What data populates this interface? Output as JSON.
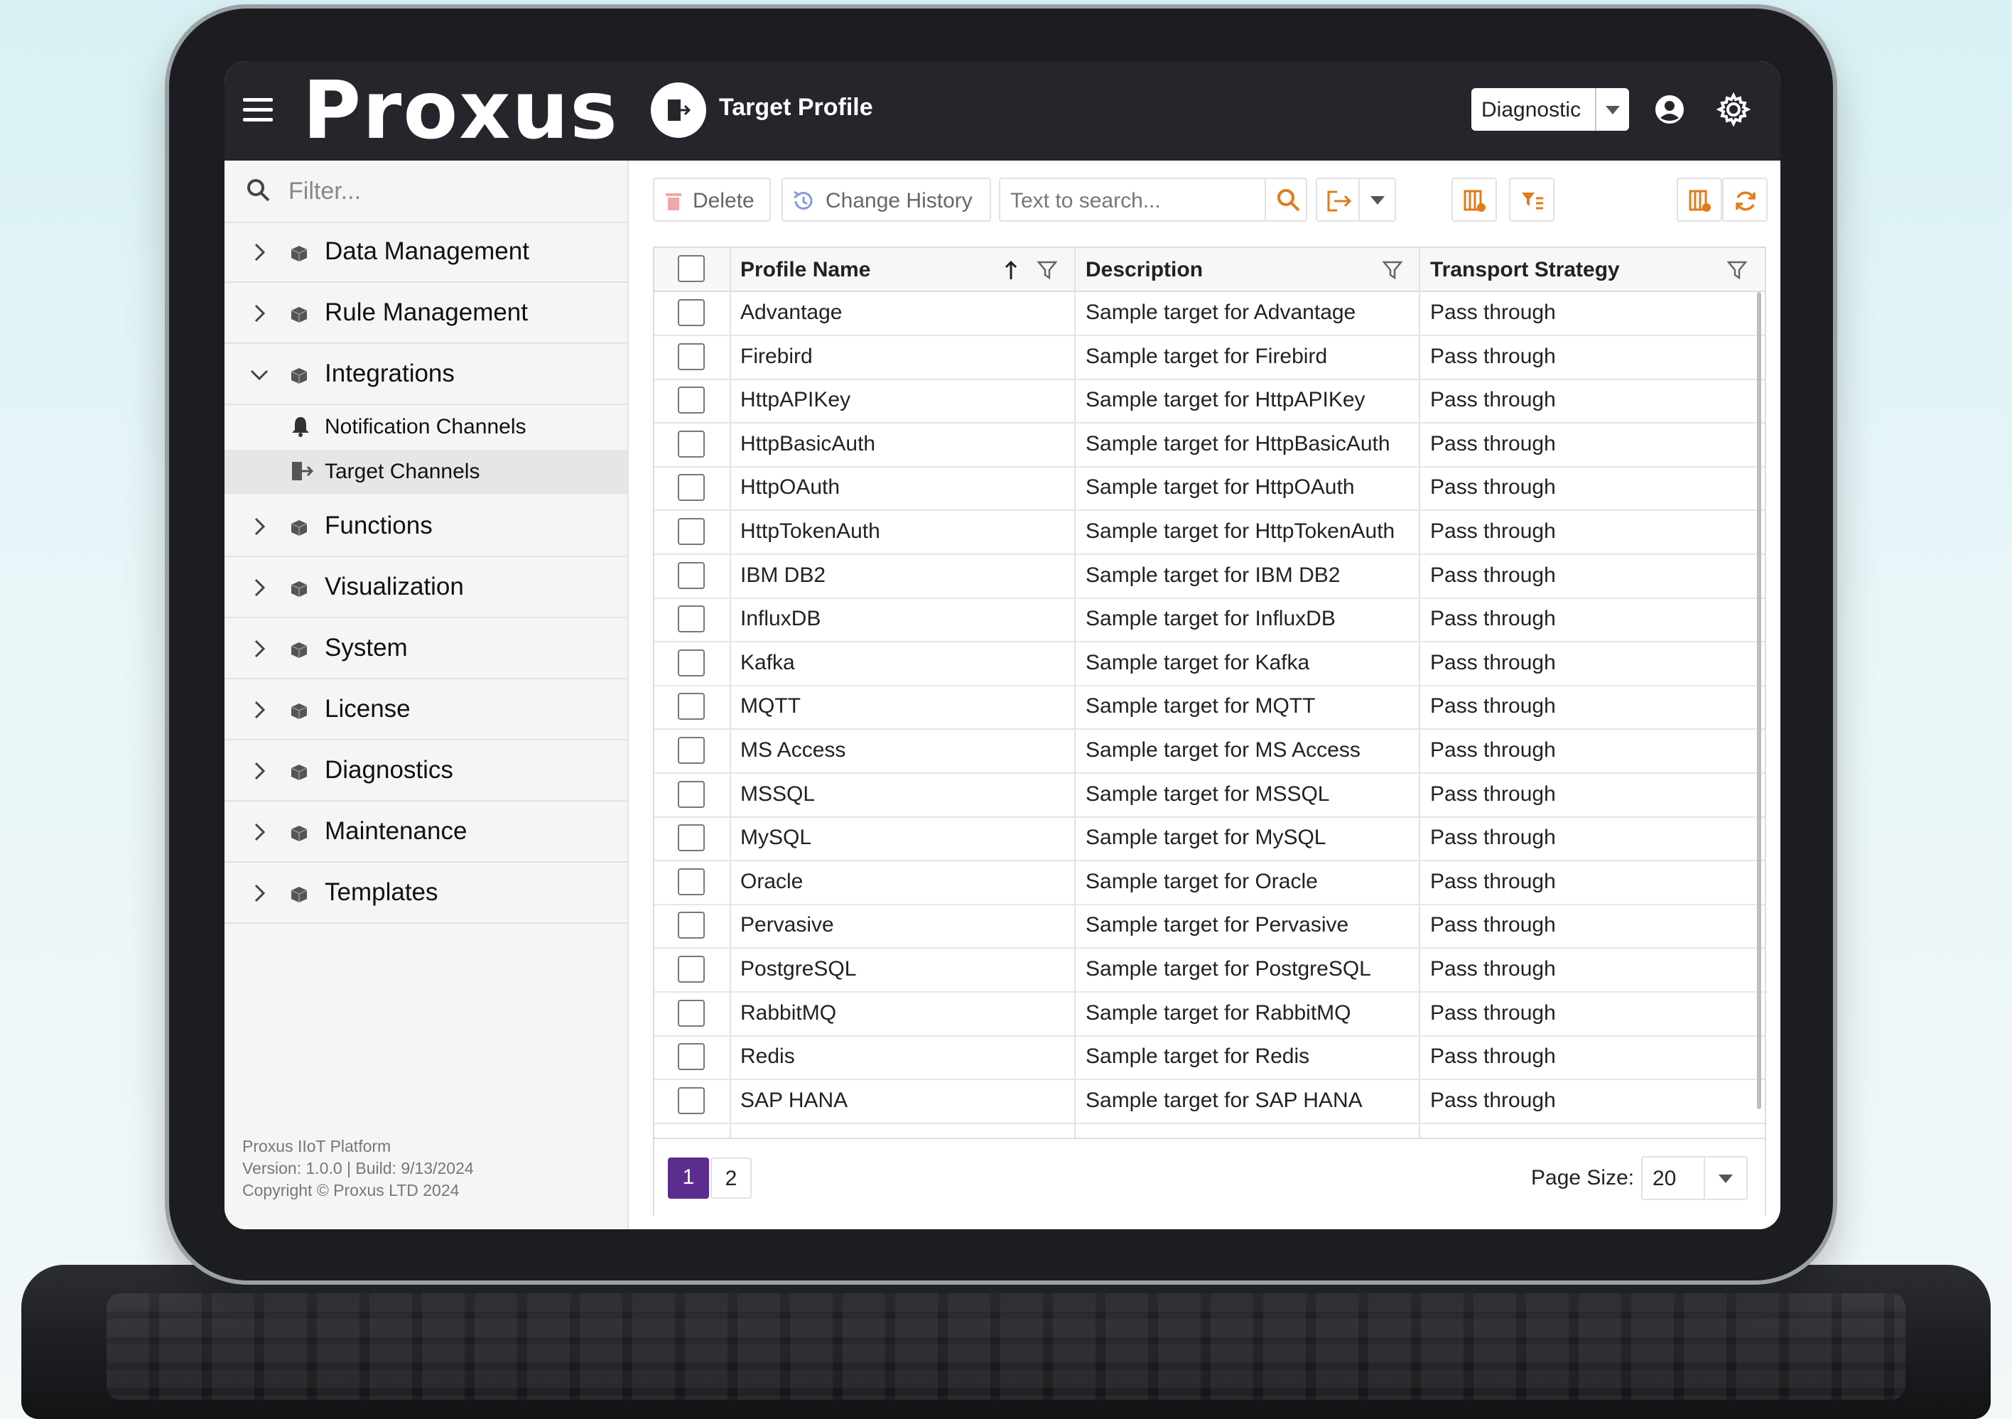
{
  "header": {
    "logo": "Proxus",
    "page_title": "Target Profile",
    "mode_select": "Diagnostic"
  },
  "sidebar": {
    "filter_placeholder": "Filter...",
    "items": [
      {
        "label": "Data Management",
        "icon": "cube-icon",
        "expanded": false
      },
      {
        "label": "Rule Management",
        "icon": "cube-icon",
        "expanded": false
      },
      {
        "label": "Integrations",
        "icon": "cube-icon",
        "expanded": true
      },
      {
        "label": "Functions",
        "icon": "cube-icon",
        "expanded": false
      },
      {
        "label": "Visualization",
        "icon": "cube-icon",
        "expanded": false
      },
      {
        "label": "System",
        "icon": "cube-icon",
        "expanded": false
      },
      {
        "label": "License",
        "icon": "cube-icon",
        "expanded": false
      },
      {
        "label": "Diagnostics",
        "icon": "cube-icon",
        "expanded": false
      },
      {
        "label": "Maintenance",
        "icon": "cube-icon",
        "expanded": false
      },
      {
        "label": "Templates",
        "icon": "cube-icon",
        "expanded": false
      }
    ],
    "subitems": [
      {
        "label": "Notification Channels",
        "icon": "bell-icon"
      },
      {
        "label": "Target Channels",
        "icon": "target-channel-icon",
        "active": true
      }
    ],
    "footer": {
      "line1": "Proxus IIoT Platform",
      "line2": "Version: 1.0.0 | Build: 9/13/2024",
      "line3": "Copyright © Proxus LTD 2024"
    }
  },
  "toolbar": {
    "delete_label": "Delete",
    "history_label": "Change History",
    "search_placeholder": "Text to search..."
  },
  "grid": {
    "columns": [
      "Profile Name",
      "Description",
      "Transport Strategy"
    ],
    "rows": [
      [
        "Advantage",
        "Sample target for Advantage",
        "Pass through"
      ],
      [
        "Firebird",
        "Sample target for Firebird",
        "Pass through"
      ],
      [
        "HttpAPIKey",
        "Sample target for HttpAPIKey",
        "Pass through"
      ],
      [
        "HttpBasicAuth",
        "Sample target for HttpBasicAuth",
        "Pass through"
      ],
      [
        "HttpOAuth",
        "Sample target for HttpOAuth",
        "Pass through"
      ],
      [
        "HttpTokenAuth",
        "Sample target for HttpTokenAuth",
        "Pass through"
      ],
      [
        "IBM DB2",
        "Sample target for IBM DB2",
        "Pass through"
      ],
      [
        "InfluxDB",
        "Sample target for InfluxDB",
        "Pass through"
      ],
      [
        "Kafka",
        "Sample target for Kafka",
        "Pass through"
      ],
      [
        "MQTT",
        "Sample target for MQTT",
        "Pass through"
      ],
      [
        "MS Access",
        "Sample target for MS Access",
        "Pass through"
      ],
      [
        "MSSQL",
        "Sample target for MSSQL",
        "Pass through"
      ],
      [
        "MySQL",
        "Sample target for MySQL",
        "Pass through"
      ],
      [
        "Oracle",
        "Sample target for Oracle",
        "Pass through"
      ],
      [
        "Pervasive",
        "Sample target for Pervasive",
        "Pass through"
      ],
      [
        "PostgreSQL",
        "Sample target for PostgreSQL",
        "Pass through"
      ],
      [
        "RabbitMQ",
        "Sample target for RabbitMQ",
        "Pass through"
      ],
      [
        "Redis",
        "Sample target for Redis",
        "Pass through"
      ],
      [
        "SAP HANA",
        "Sample target for SAP HANA",
        "Pass through"
      ]
    ]
  },
  "pager": {
    "pages": [
      "1",
      "2"
    ],
    "current_page": "1",
    "page_size_label": "Page Size:",
    "page_size": "20"
  },
  "colors": {
    "topbar": "#24262b",
    "accent_orange": "#e07b1a",
    "current_page": "#5b2d8e"
  }
}
